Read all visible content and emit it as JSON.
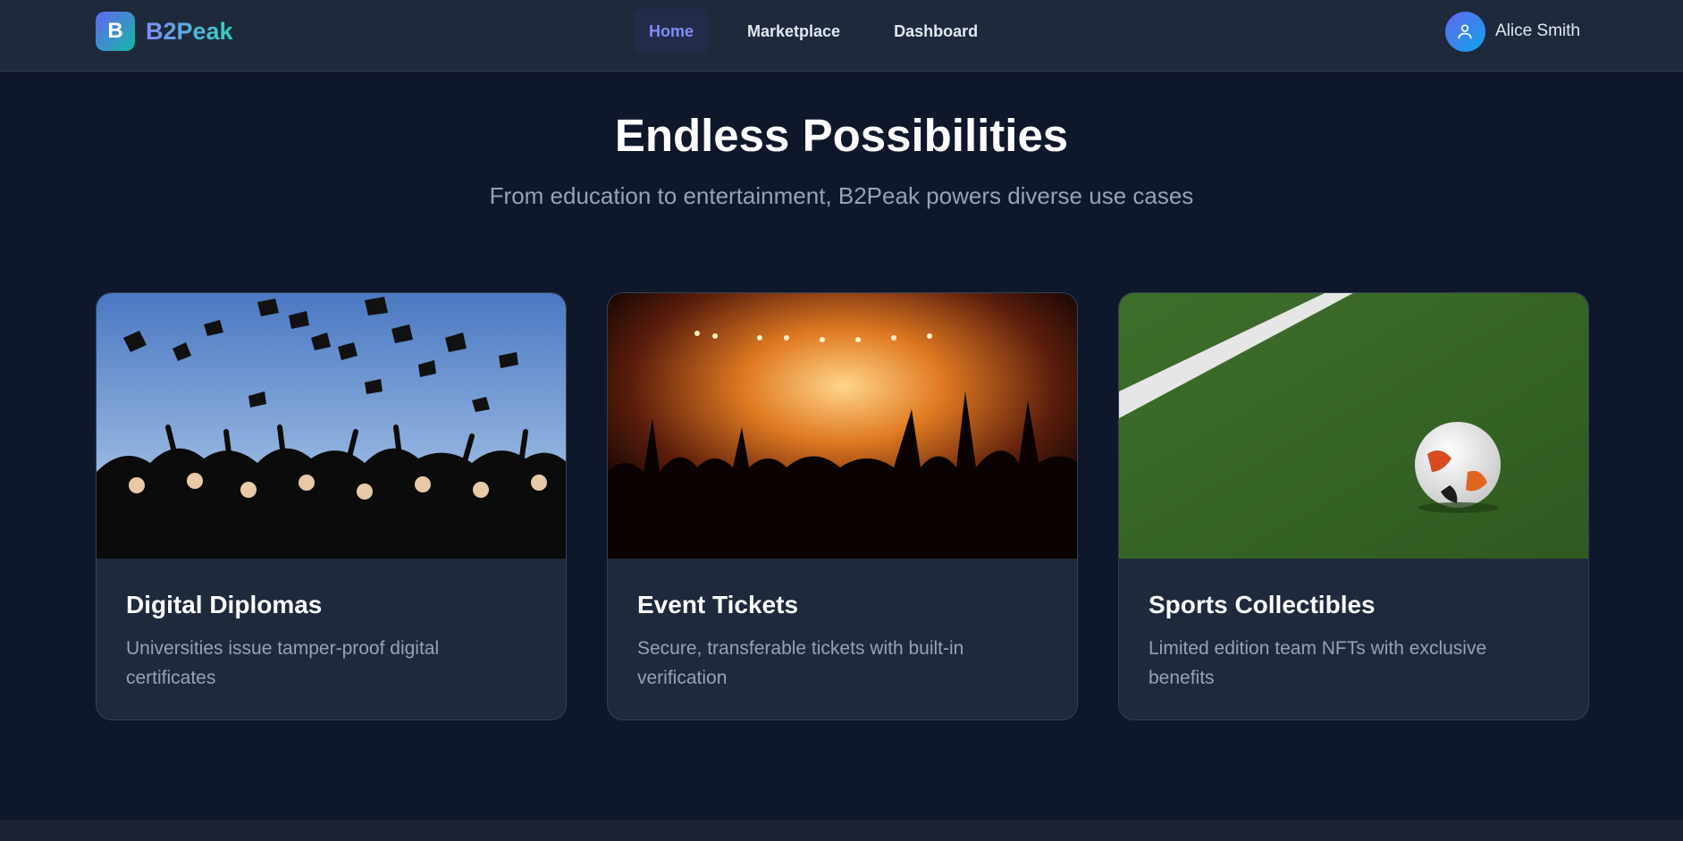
{
  "brand": {
    "initial": "B",
    "name": "B2Peak"
  },
  "nav": {
    "items": [
      {
        "label": "Home",
        "active": true
      },
      {
        "label": "Marketplace",
        "active": false
      },
      {
        "label": "Dashboard",
        "active": false
      }
    ]
  },
  "user": {
    "name": "Alice Smith",
    "icon": "user-icon"
  },
  "hero": {
    "title": "Endless Possibilities",
    "subtitle": "From education to entertainment, B2Peak powers diverse use cases"
  },
  "cards": [
    {
      "title": "Digital Diplomas",
      "description": "Universities issue tamper-proof digital certificates",
      "image": "graduation-caps-photo"
    },
    {
      "title": "Event Tickets",
      "description": "Secure, transferable tickets with built-in verification",
      "image": "concert-crowd-photo"
    },
    {
      "title": "Sports Collectibles",
      "description": "Limited edition team NFTs with exclusive benefits",
      "image": "soccer-ball-field-photo"
    }
  ],
  "colors": {
    "background": "#0f172a",
    "surface": "#1e293b",
    "accent": "#818cf8",
    "accent_teal": "#2dd4bf",
    "muted_text": "#94a3b8"
  }
}
